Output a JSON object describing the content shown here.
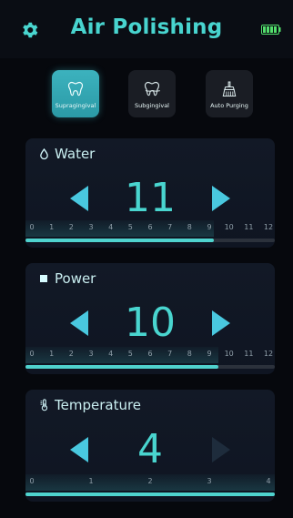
{
  "header": {
    "title": "Air Polishing",
    "settings_icon": "gear-icon",
    "battery_icon": "battery-icon"
  },
  "modes": [
    {
      "label": "Supragingival",
      "icon": "tooth-icon",
      "active": true
    },
    {
      "label": "Subgingival",
      "icon": "gum-tooth-icon",
      "active": false
    },
    {
      "label": "Auto Purging",
      "icon": "brush-icon",
      "active": false
    }
  ],
  "controls": {
    "water": {
      "label": "Water",
      "icon": "drop-icon",
      "value": "11",
      "scale": [
        "0",
        "1",
        "2",
        "3",
        "4",
        "5",
        "6",
        "7",
        "8",
        "9",
        "10",
        "11",
        "12"
      ],
      "fill_fraction": 0.7545
    },
    "power": {
      "label": "Power",
      "icon": "square-icon",
      "value": "10",
      "scale": [
        "0",
        "1",
        "2",
        "3",
        "4",
        "5",
        "6",
        "7",
        "8",
        "9",
        "10",
        "11",
        "12"
      ],
      "fill_fraction": 0.7728
    },
    "temperature": {
      "label": "Temperature",
      "icon": "thermometer-icon",
      "value": "4",
      "scale": [
        "0",
        "1",
        "2",
        "3",
        "4"
      ],
      "fill_fraction": 1.0
    }
  },
  "colors": {
    "accent": "#49d5cf",
    "panel": "#121926",
    "background": "#06080d",
    "text": "#c9eef0",
    "battery": "#53df6c"
  }
}
